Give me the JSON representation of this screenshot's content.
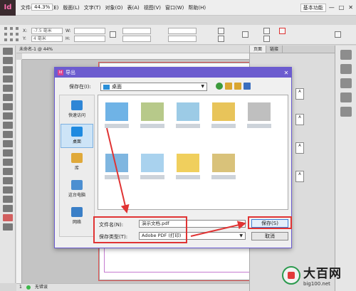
{
  "app": {
    "logo": "Id",
    "zoom": "44.3%",
    "workspace": "基本功能",
    "menus": [
      "文件(F)",
      "编辑(E)",
      "版面(L)",
      "文字(T)",
      "对象(O)",
      "表(A)",
      "视图(V)",
      "窗口(W)",
      "帮助(H)"
    ],
    "window_controls": [
      "—",
      "□",
      "✕"
    ]
  },
  "controlbar": {
    "x_label": "X:",
    "x_value": "-7.5 毫米",
    "y_label": "Y:",
    "y_value": "4 毫米",
    "w_label": "W:",
    "h_label": "H:"
  },
  "document": {
    "tab_title": "未命名-1 @ 44%"
  },
  "statusbar": {
    "page": "1",
    "preflight": "无错误"
  },
  "panels": {
    "tabs": [
      "页面",
      "链接"
    ],
    "page_labels": [
      "A",
      "A",
      "A",
      "A"
    ]
  },
  "dialog": {
    "title": "导出",
    "save_in_label": "保存在(I):",
    "save_in_value": "桌面",
    "places": [
      {
        "label": "快速访问",
        "color": "#2f86d6"
      },
      {
        "label": "桌面",
        "color": "#1f8ae0"
      },
      {
        "label": "库",
        "color": "#e0a93a"
      },
      {
        "label": "这台电脑",
        "color": "#4c8fd1"
      },
      {
        "label": "网络",
        "color": "#3a7fc7"
      }
    ],
    "file_thumbs": [
      {
        "color": "#6fb3e6"
      },
      {
        "color": "#b7c98a"
      },
      {
        "color": "#9ccbe6"
      },
      {
        "color": "#e8c45a"
      },
      {
        "color": "#bfbfbf"
      },
      {
        "color": "#7fb6e0"
      },
      {
        "color": "#a9d2ee"
      },
      {
        "color": "#f0cf5d"
      },
      {
        "color": "#d9c27a"
      }
    ],
    "filename_label": "文件名(N):",
    "filename_value": "演示文档.pdf",
    "filetype_label": "保存类型(T):",
    "filetype_value": "Adobe PDF (打印)",
    "save_button": "保存(S)",
    "cancel_button": "取消"
  },
  "watermark": {
    "brand": "大百网",
    "url": "big100.net"
  },
  "colors": {
    "dialog_title": "#6c5ccf",
    "highlight": "#e03434",
    "accent_blue": "#3c7fd6"
  }
}
